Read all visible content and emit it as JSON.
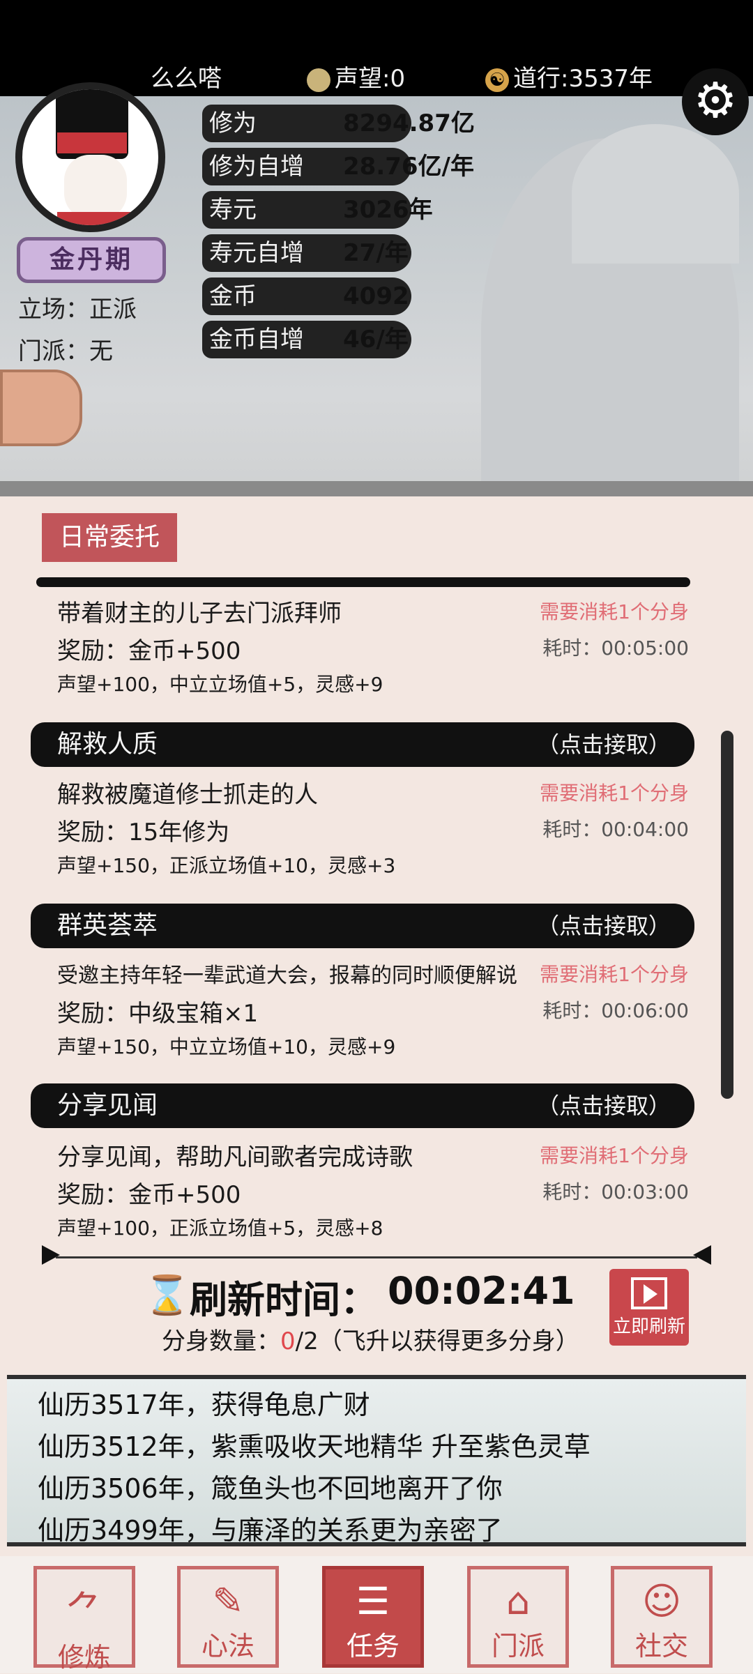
{
  "topbar": {
    "player_name": "么么嗒",
    "reputation": "声望:0",
    "dao_years": "道行:3537年"
  },
  "profile": {
    "realm": "金丹期",
    "stance": "立场：正派",
    "sect": "门派：无"
  },
  "stats": [
    {
      "label": "修为",
      "value": "8294.87亿"
    },
    {
      "label": "修为自增",
      "value": "28.76亿/年"
    },
    {
      "label": "寿元",
      "value": "3026年"
    },
    {
      "label": "寿元自增",
      "value": "27/年"
    },
    {
      "label": "金币",
      "value": "4092"
    },
    {
      "label": "金币自增",
      "value": "46/年"
    }
  ],
  "tasks_section": {
    "tag": "日常委托",
    "tasks": [
      {
        "title": "",
        "accept_label": "",
        "desc": "带着财主的儿子去门派拜师",
        "reward": "奖励：金币+500",
        "extra": "声望+100，中立立场值+5，灵感+9",
        "cost": "需要消耗1个分身",
        "time": "耗时：00:05:00"
      },
      {
        "title": "解救人质",
        "accept_label": "（点击接取）",
        "desc": "解救被魔道修士抓走的人",
        "reward": "奖励：15年修为",
        "extra": "声望+150，正派立场值+10，灵感+3",
        "cost": "需要消耗1个分身",
        "time": "耗时：00:04:00"
      },
      {
        "title": "群英荟萃",
        "accept_label": "（点击接取）",
        "desc": "受邀主持年轻一辈武道大会，报幕的同时顺便解说",
        "reward": "奖励：中级宝箱×1",
        "extra": "声望+150，中立立场值+10，灵感+9",
        "cost": "需要消耗1个分身",
        "time": "耗时：00:06:00"
      },
      {
        "title": "分享见闻",
        "accept_label": "（点击接取）",
        "desc": "分享见闻，帮助凡间歌者完成诗歌",
        "reward": "奖励：金币+500",
        "extra": "声望+100，正派立场值+5，灵感+8",
        "cost": "需要消耗1个分身",
        "time": "耗时：00:03:00"
      }
    ]
  },
  "refresh": {
    "label": "刷新时间：",
    "time": "00:02:41",
    "clone_prefix": "分身数量：",
    "clone_current": "0",
    "clone_rest": "/2（飞升以获得更多分身）",
    "button_label": "立即刷新"
  },
  "log": [
    "仙历3517年，获得龟息广财",
    "仙历3512年，紫熏吸收天地精华 升至紫色灵草",
    "仙历3506年，箴鱼头也不回地离开了你",
    "仙历3499年，与廉泽的关系更为亲密了"
  ],
  "nav": [
    {
      "label": "修炼",
      "icon": "cultivate-icon"
    },
    {
      "label": "心法",
      "icon": "scroll-icon"
    },
    {
      "label": "任务",
      "icon": "task-icon"
    },
    {
      "label": "门派",
      "icon": "sect-icon"
    },
    {
      "label": "社交",
      "icon": "social-icon"
    }
  ],
  "colors": {
    "accent_red": "#c24a4a",
    "cost_pink": "#e06d75",
    "realm_purple": "#cdb4dd"
  }
}
